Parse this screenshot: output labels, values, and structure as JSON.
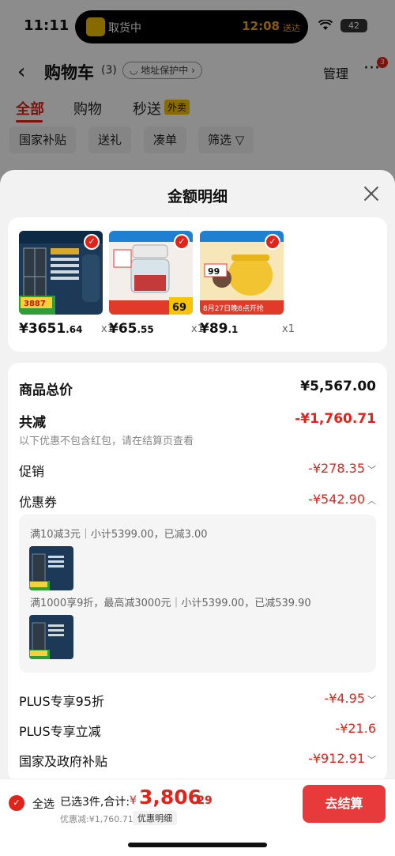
{
  "status_bar": {
    "time": "11:11",
    "island_text": "取货中",
    "island_time": "12:08",
    "island_time_suffix": "送达",
    "battery": "42"
  },
  "nav": {
    "title": "购物车",
    "count": "(3)",
    "address_pill": "◡ 地址保护中 ›",
    "manage": "管理",
    "more_badge": "3"
  },
  "tabs": [
    {
      "label": "全部",
      "active": true
    },
    {
      "label": "购物",
      "active": false
    },
    {
      "label": "秒送",
      "active": false
    }
  ],
  "waimai_badge": "外卖",
  "filters": [
    "国家补贴",
    "送礼",
    "凑单",
    "筛选 ▽"
  ],
  "sheet": {
    "title": "金额明细",
    "products": [
      {
        "price_int": "¥3651",
        "price_dec": ".64",
        "qty": "x1",
        "theme": "fridge",
        "img_price": "3887"
      },
      {
        "price_int": "¥65",
        "price_dec": ".55",
        "qty": "x1",
        "theme": "chopper",
        "img_price": "69"
      },
      {
        "price_int": "¥89",
        "price_dec": ".1",
        "qty": "x1",
        "theme": "cooker",
        "img_price": "99",
        "img_banner": "8月27日晚8点开抢"
      }
    ],
    "rows": {
      "total_label": "商品总价",
      "total_value": "¥5,567.00",
      "reduce_label": "共减",
      "reduce_value": "-¥1,760.71",
      "reduce_note": "以下优惠不包含红包，请在结算页查看",
      "promo_label": "促销",
      "promo_value": "-¥278.35",
      "coupon_label": "优惠券",
      "coupon_value": "-¥542.90",
      "plus95_label": "PLUS专享95折",
      "plus95_value": "-¥4.95",
      "plusdirect_label": "PLUS专享立减",
      "plusdirect_value": "-¥21.6",
      "subsidy_label": "国家及政府补贴",
      "subsidy_value": "-¥912.91"
    },
    "coupon_details": [
      "满10减3元｜小计5399.00，已减3.00",
      "满1000享9折，最高减3000元｜小计5399.00，已减539.90"
    ]
  },
  "bottom": {
    "select_all": "全选",
    "selected": "已选3件,合计:",
    "currency": "¥",
    "total_int": "3,806",
    "total_dec": ".29",
    "discount_note": "优惠减:¥1,760.71",
    "detail_tag": "优惠明细",
    "checkout": "去结算"
  },
  "colors": {
    "accent": "#e2231a",
    "checkout": "#e83a3a"
  }
}
